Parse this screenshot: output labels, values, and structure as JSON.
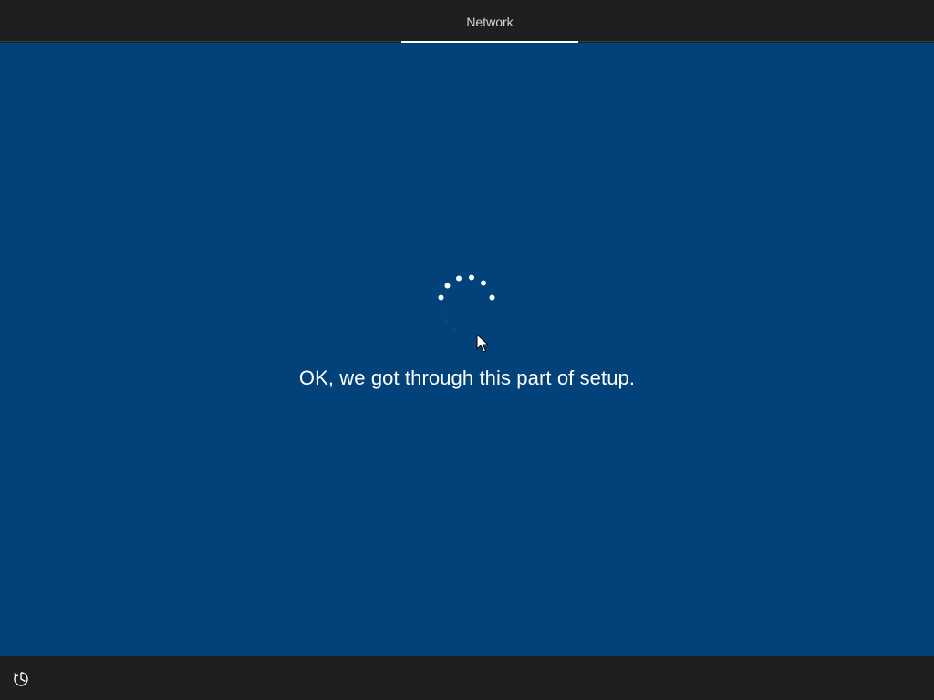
{
  "header": {
    "tabs": [
      {
        "label": "Network",
        "active": true
      }
    ]
  },
  "main": {
    "message": "OK, we got through this part of setup.",
    "background_color": "#02427a",
    "spinner_icon": "loading-spinner-icon"
  },
  "footer": {
    "ease_of_access_icon": "ease-of-access-icon"
  },
  "cursor_icon": "mouse-pointer-icon"
}
